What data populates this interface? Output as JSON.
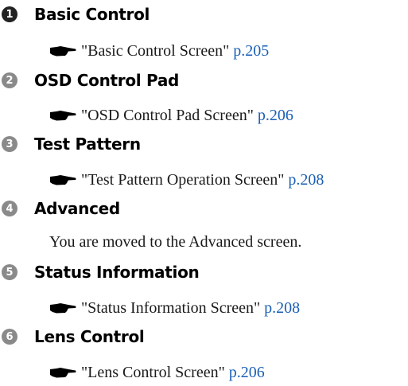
{
  "accent_colors": {
    "badge_primary": "#222222",
    "badge_secondary": "#8a8a8a",
    "link": "#1a5fb4"
  },
  "icons": {
    "reference": "pointing-hand-icon"
  },
  "items": [
    {
      "number": "1",
      "title": "Basic Control",
      "ref_text": "\"Basic Control Screen\"",
      "ref_page": "p.205"
    },
    {
      "number": "2",
      "title": "OSD Control Pad",
      "ref_text": "\"OSD Control Pad Screen\"",
      "ref_page": "p.206"
    },
    {
      "number": "3",
      "title": "Test Pattern",
      "ref_text": "\"Test Pattern Operation Screen\"",
      "ref_page": "p.208"
    },
    {
      "number": "4",
      "title": "Advanced",
      "description": "You are moved to the Advanced screen."
    },
    {
      "number": "5",
      "title": "Status Information",
      "ref_text": "\"Status Information Screen\"",
      "ref_page": "p.208"
    },
    {
      "number": "6",
      "title": "Lens Control",
      "ref_text": "\"Lens Control Screen\"",
      "ref_page": "p.206"
    }
  ]
}
